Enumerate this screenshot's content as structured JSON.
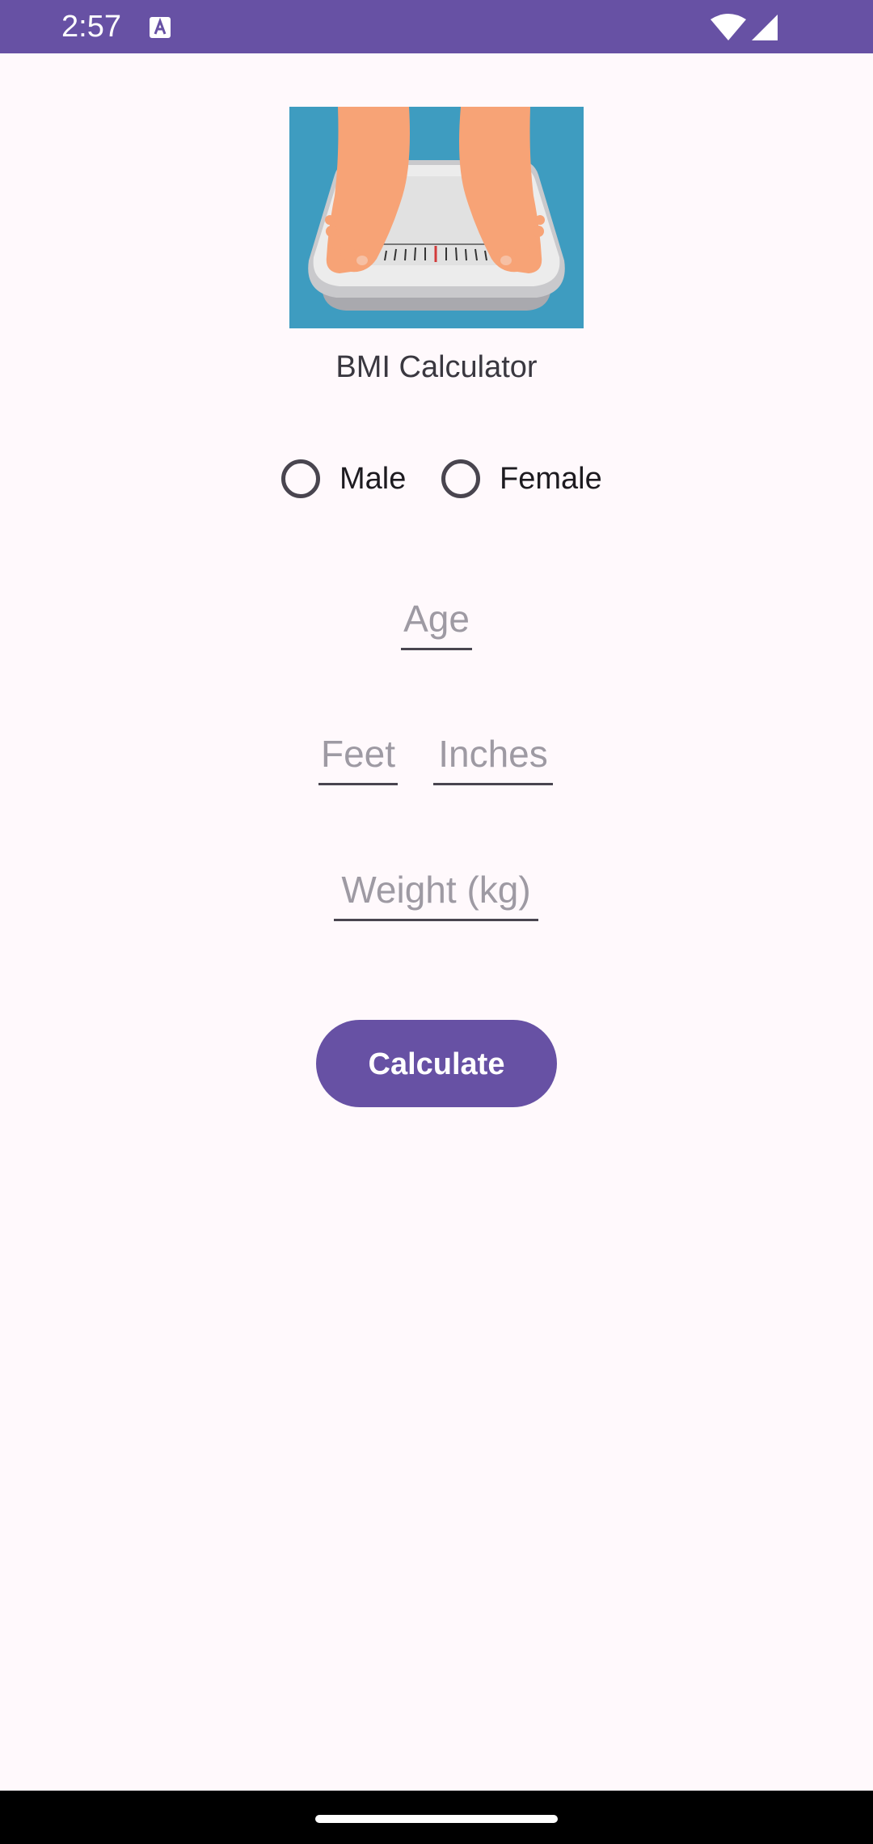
{
  "status_bar": {
    "time": "2:57",
    "background": "#6751A4",
    "icons": [
      "notification-a-icon",
      "wifi-icon",
      "signal-icon"
    ]
  },
  "hero": {
    "image": "bathroom-scale-feet-illustration",
    "background": "#3E9CC0"
  },
  "app": {
    "title": "BMI Calculator"
  },
  "gender": {
    "options": [
      {
        "label": "Male",
        "selected": false
      },
      {
        "label": "Female",
        "selected": false
      }
    ]
  },
  "form": {
    "age_placeholder": "Age",
    "feet_placeholder": "Feet",
    "inches_placeholder": "Inches",
    "weight_placeholder": "Weight (kg)",
    "age_value": "",
    "feet_value": "",
    "inches_value": "",
    "weight_value": ""
  },
  "actions": {
    "calculate_label": "Calculate",
    "accent": "#6751A4"
  }
}
